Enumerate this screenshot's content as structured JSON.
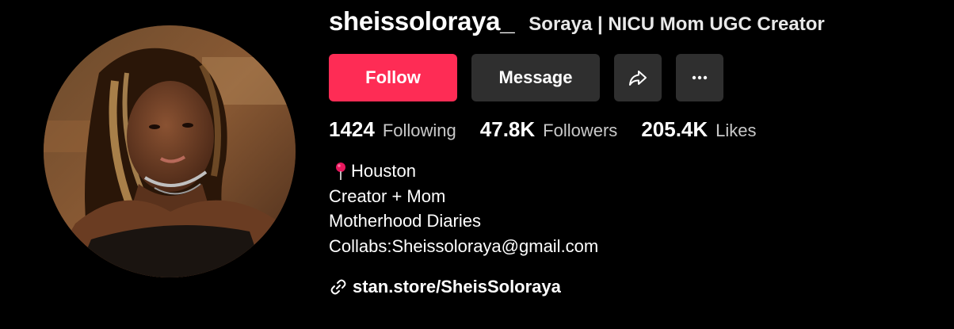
{
  "profile": {
    "username": "sheissoloraya_",
    "nickname": "Soraya | NICU Mom UGC Creator"
  },
  "actions": {
    "follow_label": "Follow",
    "message_label": "Message",
    "share_icon": "share-icon",
    "more_icon": "more-horizontal-icon"
  },
  "stats": [
    {
      "value": "1424",
      "label": "Following"
    },
    {
      "value": "47.8K",
      "label": "Followers"
    },
    {
      "value": "205.4K",
      "label": "Likes"
    }
  ],
  "bio": {
    "location_icon": "pushpin-icon",
    "lines": [
      "Houston",
      "Creator + Mom",
      "Motherhood Diaries",
      "Collabs:Sheissoloraya@gmail.com"
    ]
  },
  "link": {
    "icon": "link-icon",
    "text": "stan.store/SheisSoloraya"
  },
  "colors": {
    "background": "#000000",
    "follow_button": "#fe2c55",
    "secondary_button": "#2f2f2f",
    "pin": "#e8175d"
  }
}
